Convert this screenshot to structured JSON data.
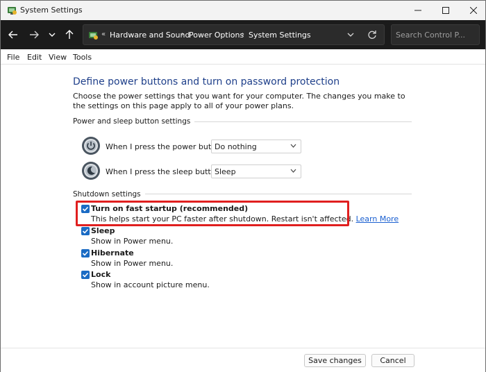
{
  "window": {
    "title": "System Settings"
  },
  "navbar": {
    "breadcrumb": [
      "Hardware and Sound",
      "Power Options",
      "System Settings"
    ],
    "search_placeholder": "Search Control P..."
  },
  "menu": [
    "File",
    "Edit",
    "View",
    "Tools"
  ],
  "main": {
    "heading": "Define power buttons and turn on password protection",
    "description": "Choose the power settings that you want for your computer. The changes you make to the settings on this page apply to all of your power plans.",
    "power_group_label": "Power and sleep button settings",
    "power_button_label": "When I press the power button:",
    "power_button_value": "Do nothing",
    "sleep_button_label": "When I press the sleep button:",
    "sleep_button_value": "Sleep",
    "shutdown_group_label": "Shutdown settings",
    "shutdown_options": [
      {
        "title": "Turn on fast startup (recommended)",
        "desc": "This helps start your PC faster after shutdown. Restart isn't affected. ",
        "link": "Learn More",
        "checked": true
      },
      {
        "title": "Sleep",
        "desc": "Show in Power menu.",
        "checked": true
      },
      {
        "title": "Hibernate",
        "desc": "Show in Power menu.",
        "checked": true
      },
      {
        "title": "Lock",
        "desc": "Show in account picture menu.",
        "checked": true
      }
    ]
  },
  "footer": {
    "save_label": "Save changes",
    "cancel_label": "Cancel"
  },
  "colors": {
    "accent": "#1a6bc4",
    "heading": "#1e3f8a",
    "highlight": "#e01f1f",
    "navbar": "#1b1b1b"
  }
}
